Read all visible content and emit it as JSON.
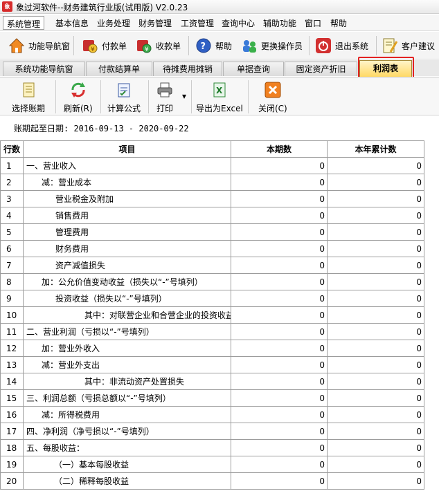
{
  "window": {
    "title": "象过河软件--财务建筑行业版(试用版) V2.0.23",
    "app_icon_text": "象"
  },
  "menu": [
    "系统管理",
    "基本信息",
    "业务处理",
    "财务管理",
    "工资管理",
    "查询中心",
    "辅助功能",
    "窗口",
    "帮助"
  ],
  "quickbar": {
    "items": [
      {
        "label": "功能导航窗",
        "icon": "home-icon"
      },
      {
        "label": "付款单",
        "icon": "payment-icon"
      },
      {
        "label": "收款单",
        "icon": "receipt-icon"
      },
      {
        "label": "帮助",
        "icon": "help-icon"
      },
      {
        "label": "更换操作员",
        "icon": "switch-user-icon"
      },
      {
        "label": "退出系统",
        "icon": "exit-icon"
      },
      {
        "label": "客户建议",
        "icon": "feedback-icon"
      }
    ]
  },
  "tabs": [
    {
      "label": "系统功能导航窗",
      "active": false
    },
    {
      "label": "付款结算单",
      "active": false
    },
    {
      "label": "待摊费用摊销",
      "active": false
    },
    {
      "label": "单据查询",
      "active": false
    },
    {
      "label": "固定资产折旧",
      "active": false
    },
    {
      "label": "利润表",
      "active": true
    }
  ],
  "toolbar": {
    "items": [
      {
        "label": "选择账期",
        "icon": "select-period-icon"
      },
      {
        "label": "刷新(R)",
        "icon": "refresh-icon"
      },
      {
        "label": "计算公式",
        "icon": "formula-icon"
      },
      {
        "label": "打印",
        "icon": "print-icon"
      },
      {
        "label": "导出为Excel",
        "icon": "excel-export-icon"
      },
      {
        "label": "关闭(C)",
        "icon": "close-icon"
      }
    ],
    "print_dropdown": "▾"
  },
  "period_text": "账期起至日期: 2016-09-13 - 2020-09-22",
  "table": {
    "headers": [
      "行数",
      "项目",
      "本期数",
      "本年累计数"
    ],
    "rows": [
      {
        "no": "1",
        "item": "一、营业收入",
        "indent": 0,
        "current": "0",
        "ytd": "0"
      },
      {
        "no": "2",
        "item": "减：营业成本",
        "indent": 1,
        "current": "0",
        "ytd": "0"
      },
      {
        "no": "3",
        "item": "营业税金及附加",
        "indent": 3,
        "current": "0",
        "ytd": "0"
      },
      {
        "no": "4",
        "item": "销售费用",
        "indent": 3,
        "current": "0",
        "ytd": "0"
      },
      {
        "no": "5",
        "item": "管理费用",
        "indent": 3,
        "current": "0",
        "ytd": "0"
      },
      {
        "no": "6",
        "item": "财务费用",
        "indent": 3,
        "current": "0",
        "ytd": "0"
      },
      {
        "no": "7",
        "item": "资产减值损失",
        "indent": 3,
        "current": "0",
        "ytd": "0"
      },
      {
        "no": "8",
        "item": "加：公允价值变动收益（损失以“-”号填列）",
        "indent": 1,
        "current": "0",
        "ytd": "0"
      },
      {
        "no": "9",
        "item": "投资收益（损失以“-”号填列）",
        "indent": 3,
        "current": "0",
        "ytd": "0"
      },
      {
        "no": "10",
        "item": "其中：对联营企业和合营企业的投资收益",
        "indent": 4,
        "current": "0",
        "ytd": "0"
      },
      {
        "no": "11",
        "item": "二、营业利润（亏损以“-”号填列）",
        "indent": 0,
        "current": "0",
        "ytd": "0"
      },
      {
        "no": "12",
        "item": "加：营业外收入",
        "indent": 1,
        "current": "0",
        "ytd": "0"
      },
      {
        "no": "13",
        "item": "减：营业外支出",
        "indent": 1,
        "current": "0",
        "ytd": "0"
      },
      {
        "no": "14",
        "item": "其中：非流动资产处置损失",
        "indent": 4,
        "current": "0",
        "ytd": "0"
      },
      {
        "no": "15",
        "item": "三、利润总额（亏损总额以“-”号填列）",
        "indent": 0,
        "current": "0",
        "ytd": "0"
      },
      {
        "no": "16",
        "item": "减：所得税费用",
        "indent": 1,
        "current": "0",
        "ytd": "0"
      },
      {
        "no": "17",
        "item": "四、净利润（净亏损以“-”号填列）",
        "indent": 0,
        "current": "0",
        "ytd": "0"
      },
      {
        "no": "18",
        "item": "五、每股收益：",
        "indent": 0,
        "current": "0",
        "ytd": "0"
      },
      {
        "no": "19",
        "item": "（一）基本每股收益",
        "indent": 2,
        "current": "0",
        "ytd": "0"
      },
      {
        "no": "20",
        "item": "（二）稀释每股收益",
        "indent": 2,
        "current": "0",
        "ytd": "0"
      }
    ]
  },
  "colors": {
    "active_tab": "#ffd966",
    "highlight": "#e32222"
  }
}
